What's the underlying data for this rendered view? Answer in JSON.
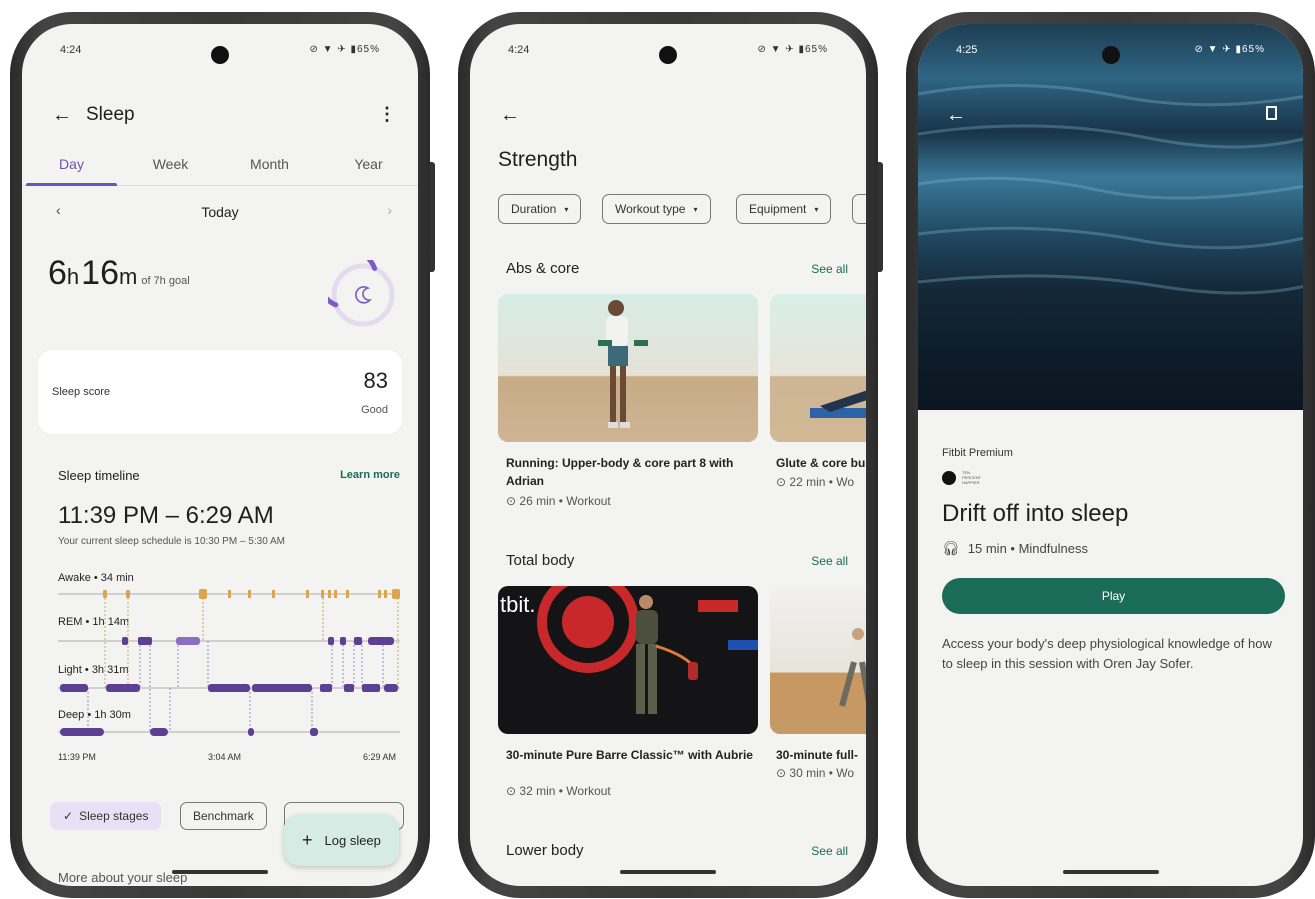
{
  "phone1": {
    "status_time": "4:24",
    "status_icons": "⊘ ▼ ✈ ▮65%",
    "title": "Sleep",
    "tabs": [
      "Day",
      "Week",
      "Month",
      "Year"
    ],
    "date_label": "Today",
    "duration_h": "6",
    "duration_h_unit": "h",
    "duration_m": "16",
    "duration_m_unit": "m",
    "goal_text": "of 7h goal",
    "score_label": "Sleep score",
    "score_value": "83",
    "score_rating": "Good",
    "timeline_title": "Sleep timeline",
    "learn_more": "Learn more",
    "time_range": "11:39 PM – 6:29 AM",
    "schedule_text": "Your current sleep schedule is 10:30 PM – 5:30 AM",
    "stages": {
      "awake": "Awake • 34 min",
      "rem": "REM • 1h 14m",
      "light": "Light • 3h 31m",
      "deep": "Deep • 1h 30m"
    },
    "axis": [
      "11:39 PM",
      "3:04 AM",
      "6:29 AM"
    ],
    "chips": [
      "Sleep stages",
      "Benchmark"
    ],
    "fab_label": "Log sleep",
    "footer_partial": "More about your sleep",
    "colors": {
      "accent": "#6e52b8",
      "awake": "#d9a64f",
      "stage": "#5d3f93"
    }
  },
  "phone2": {
    "status_time": "4:24",
    "status_icons": "⊘ ▼ ✈ ▮65%",
    "title": "Strength",
    "filters": [
      "Duration",
      "Workout type",
      "Equipment"
    ],
    "sections": [
      {
        "title": "Abs & core",
        "see_all": "See all",
        "cards": [
          {
            "title": "Running: Upper-body & core part 8 with Adrian",
            "meta": "26 min • Workout"
          },
          {
            "title": "Glute & core bu",
            "meta": "22 min • Wo"
          }
        ]
      },
      {
        "title": "Total body",
        "see_all": "See all",
        "cards": [
          {
            "title": "30-minute Pure Barre Classic™ with Aubrie",
            "meta": "32 min • Workout",
            "brand": "tbit."
          },
          {
            "title": "30-minute full-",
            "meta": "30 min • Wo"
          }
        ]
      },
      {
        "title": "Lower body",
        "see_all": "See all"
      }
    ]
  },
  "phone3": {
    "status_time": "4:25",
    "status_icons": "⊘ ▼ ✈ ▮65%",
    "premium_label": "Fitbit Premium",
    "partner_text": "TEN PERCENT HAPPIER",
    "title": "Drift off into sleep",
    "meta": "15 min • Mindfulness",
    "play_label": "Play",
    "description": "Access your body's deep physiological knowledge of how to sleep in this session with Oren Jay Sofer.",
    "colors": {
      "play": "#1a6b57"
    }
  }
}
